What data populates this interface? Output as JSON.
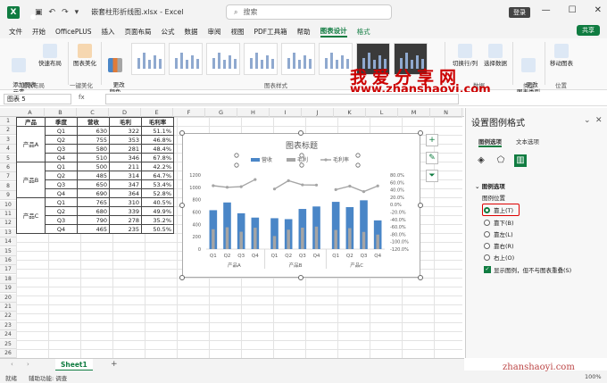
{
  "titlebar": {
    "filename": "嵌套柱形折线图.xlsx - Excel",
    "search_placeholder": "搜索",
    "login_label": "登录",
    "minimize": "—",
    "maximize": "☐",
    "close": "✕",
    "logo": "X"
  },
  "menu": {
    "items": [
      "文件",
      "开始",
      "OfficePLUS",
      "插入",
      "页面布局",
      "公式",
      "数据",
      "审阅",
      "视图",
      "PDF工具箱",
      "帮助",
      "图表设计",
      "格式"
    ],
    "active_index": 11,
    "share_label": "共享"
  },
  "ribbon": {
    "add_element": "添加图表\n元素",
    "quick_layout": "快速布局",
    "beautify": "图表美化",
    "change_colors": "更改\n颜色",
    "group_layout": "图表布局",
    "group_beautify": "一键美化",
    "group_styles": "图表样式",
    "switch_row_col": "切换行/列",
    "select_data": "选择数据",
    "group_data": "数据",
    "change_type": "更改\n图表类型",
    "group_type": "类型",
    "move_chart": "移动图表",
    "group_location": "位置"
  },
  "formulabar": {
    "namebox": "图表 5",
    "fx": "fx"
  },
  "columns": [
    "A",
    "B",
    "C",
    "D",
    "E",
    "F",
    "G",
    "H",
    "I",
    "J",
    "K",
    "L",
    "M",
    "N"
  ],
  "rows": [
    "1",
    "2",
    "3",
    "4",
    "5",
    "6",
    "7",
    "8",
    "9",
    "10",
    "11",
    "12",
    "13",
    "14",
    "15",
    "16",
    "17",
    "18",
    "19",
    "20",
    "21",
    "22",
    "23",
    "24",
    "25",
    "26"
  ],
  "table": {
    "headers": [
      "产品",
      "季度",
      "营收",
      "毛利",
      "毛利率"
    ],
    "groups": [
      {
        "product": "产品A",
        "rows": [
          [
            "Q1",
            "630",
            "322",
            "51.1%"
          ],
          [
            "Q2",
            "755",
            "353",
            "46.8%"
          ],
          [
            "Q3",
            "580",
            "281",
            "48.4%"
          ],
          [
            "Q4",
            "510",
            "346",
            "67.8%"
          ]
        ]
      },
      {
        "product": "产品B",
        "rows": [
          [
            "Q1",
            "500",
            "211",
            "42.2%"
          ],
          [
            "Q2",
            "485",
            "314",
            "64.7%"
          ],
          [
            "Q3",
            "650",
            "347",
            "53.4%"
          ],
          [
            "Q4",
            "690",
            "364",
            "52.8%"
          ]
        ]
      },
      {
        "product": "产品C",
        "rows": [
          [
            "Q1",
            "765",
            "310",
            "40.5%"
          ],
          [
            "Q2",
            "680",
            "339",
            "49.9%"
          ],
          [
            "Q3",
            "790",
            "278",
            "35.2%"
          ],
          [
            "Q4",
            "465",
            "235",
            "50.5%"
          ]
        ]
      }
    ]
  },
  "chart_data": {
    "type": "bar",
    "title": "图表标题",
    "categories": [
      "Q1",
      "Q2",
      "Q3",
      "Q4",
      "Q1",
      "Q2",
      "Q3",
      "Q4",
      "Q1",
      "Q2",
      "Q3",
      "Q4"
    ],
    "group_labels": [
      "产品A",
      "产品B",
      "产品C"
    ],
    "series": [
      {
        "name": "营收",
        "type": "bar",
        "axis": "left",
        "color": "#4a86c7",
        "values": [
          630,
          755,
          580,
          510,
          500,
          485,
          650,
          690,
          765,
          680,
          790,
          465
        ]
      },
      {
        "name": "毛利",
        "type": "bar",
        "axis": "left",
        "color": "#a5a5a5",
        "values": [
          322,
          353,
          281,
          346,
          211,
          314,
          347,
          364,
          310,
          339,
          278,
          235
        ]
      },
      {
        "name": "毛利率",
        "type": "line",
        "axis": "right",
        "color": "#a5a5a5",
        "values": [
          51.1,
          46.8,
          48.4,
          67.8,
          42.2,
          64.7,
          53.4,
          52.8,
          40.5,
          49.9,
          35.2,
          50.5
        ]
      }
    ],
    "y_ticks": [
      "1200",
      "1000",
      "800",
      "600",
      "400",
      "200",
      "0"
    ],
    "ylim": [
      0,
      1200
    ],
    "y2_ticks": [
      "80.0%",
      "60.0%",
      "40.0%",
      "20.0%",
      "0.0%",
      "-20.0%",
      "-40.0%",
      "-60.0%",
      "-80.0%",
      "-100.0%",
      "-120.0%"
    ],
    "y2lim": [
      -120,
      80
    ],
    "legend_position": "top"
  },
  "panel": {
    "title": "设置图例格式",
    "tab_legend": "图例选项",
    "tab_text": "文本选项",
    "section": "图例选项",
    "position_label": "图例位置",
    "options": [
      "靠上(T)",
      "靠下(B)",
      "靠左(L)",
      "靠右(R)",
      "右上(O)"
    ],
    "selected_index": 0,
    "checkbox_label": "显示图例，但不与图表重叠(S)"
  },
  "sheet": {
    "tab": "Sheet1",
    "add": "+"
  },
  "status": {
    "ready": "就绪",
    "accessibility": "辅助功能: 调查",
    "zoom": "100%"
  },
  "watermark": {
    "line1": "我爱分享网",
    "line2": "www.zhanshaoyi.com",
    "line3": "zhanshaoyi.com"
  }
}
